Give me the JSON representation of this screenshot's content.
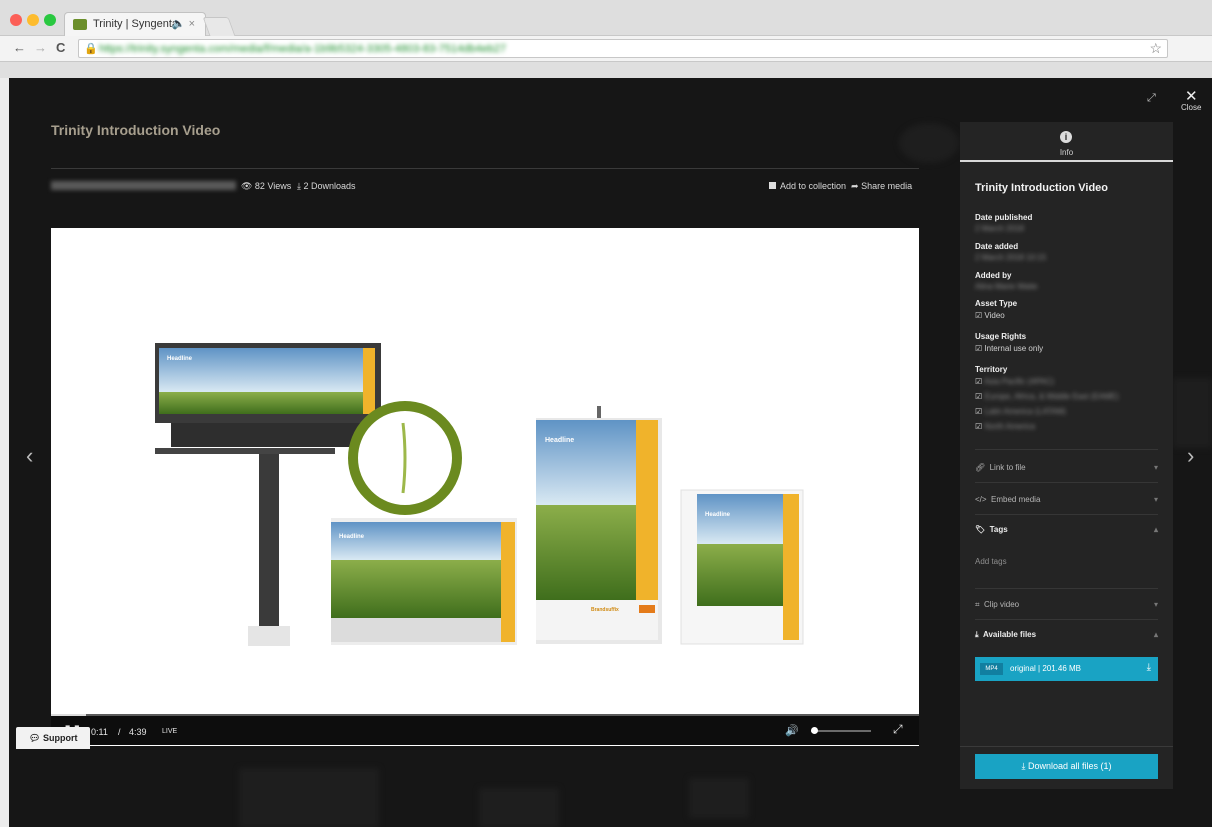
{
  "browser": {
    "tab_title": "Trinity | Syngenta",
    "tab_audio": "🔈",
    "tab_close": "×",
    "url": "https://trinity.syngenta.com/media/f/media/a-1b9b5324-3305-4803-83-7514db4eb27",
    "back": "←",
    "forward": "→",
    "reload": "C",
    "lock": "🔒",
    "star": "☆"
  },
  "media": {
    "title": "Trinity Introduction Video",
    "id_blurred": "0c1980e0a-03bf-4b2d-8f19-f7b19c84",
    "views": "👁 82 Views",
    "downloads": "⤓ 2 Downloads",
    "add_to_collection": "Add to collection",
    "share_media": "Share media",
    "nav_prev": "‹",
    "nav_next": "›"
  },
  "player": {
    "pause": "❚❚",
    "current_time": "0:11",
    "time_separator": "/",
    "duration": "4:39",
    "live": "LIVE",
    "volume": "🔊",
    "progress": 0.04,
    "volume_level": 0.0,
    "fullscreen": "⤢"
  },
  "graphic": {
    "headline": "Headline",
    "brand": "Brandsuffix",
    "brand_mark": "syngenta"
  },
  "panel": {
    "tab_icon": "i",
    "tab_label": "Info",
    "title": "Trinity Introduction Video",
    "fields": [
      {
        "label": "Date published",
        "value": "2 March 2018"
      },
      {
        "label": "Date added",
        "value": "2 March 2018 10:15"
      },
      {
        "label": "Added by",
        "value": "Alina Marie Waite"
      }
    ],
    "asset_type": {
      "label": "Asset Type",
      "value": "Video"
    },
    "usage_rights": {
      "label": "Usage Rights",
      "value": "Internal use only"
    },
    "territory": {
      "label": "Territory",
      "items": [
        "Asia Pacific (APAC)",
        "Europe, Africa, & Middle East (EAME)",
        "Latin America (LATAM)",
        "North America"
      ]
    },
    "sections": {
      "link_to_file": "Link to file",
      "embed_media": "Embed media",
      "tags": "Tags",
      "add_tags": "Add tags",
      "clip_video": "Clip video",
      "available_files": "Available files"
    },
    "file": {
      "format": "MP4",
      "name": "original | 201.46 MB"
    },
    "download_all": "⤓ Download all files (1)"
  },
  "overlay": {
    "expand": "⤢",
    "close_icon": "✕",
    "close_label": "Close",
    "support": "Support"
  },
  "colors": {
    "accent": "#19a3c4",
    "title": "#a79f8e",
    "circle": "#6b8a1f"
  }
}
